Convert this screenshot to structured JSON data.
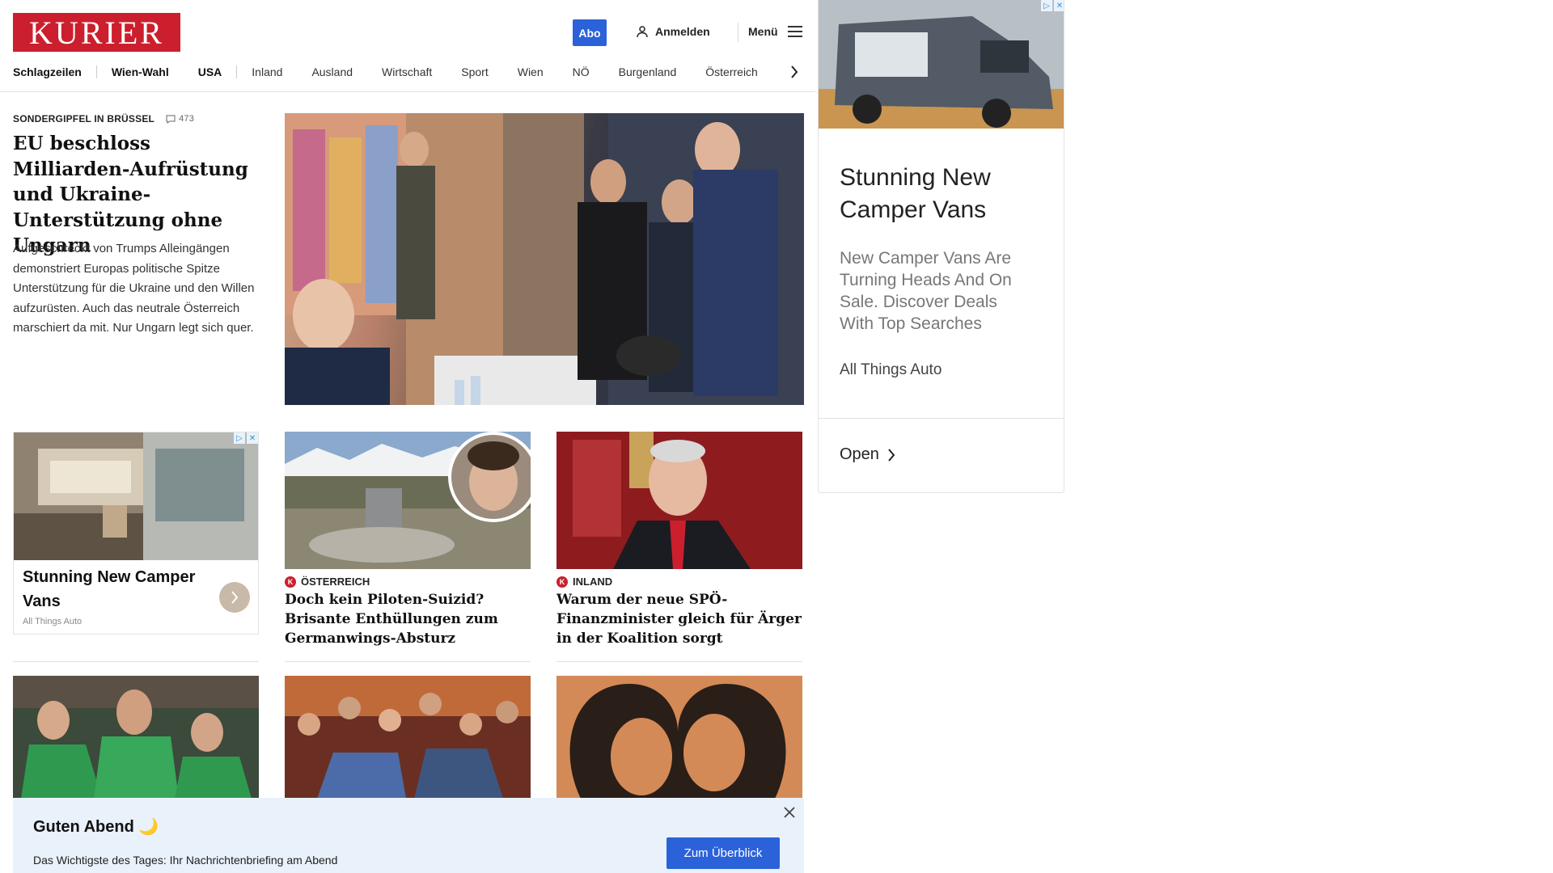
{
  "header": {
    "logo": "KURIER",
    "abo_label": "Abo",
    "login_label": "Anmelden",
    "menu_label": "Menü"
  },
  "nav": {
    "items": [
      "Schlagzeilen",
      "Wien-Wahl",
      "USA",
      "Inland",
      "Ausland",
      "Wirtschaft",
      "Sport",
      "Wien",
      "NÖ",
      "Burgenland",
      "Österreich"
    ]
  },
  "lead": {
    "kicker": "SONDERGIPFEL IN BRÜSSEL",
    "comment_count": "473",
    "title": "EU beschloss Milliarden-Aufrüstung und Ukraine-Unterstützung ohne Ungarn",
    "teaser": "Aufgeschreckt von Trumps Alleingängen demonstriert Europas politische Spitze Unterstützung für die Ukraine und den Willen aufzurüsten. Auch das neutrale Österreich marschiert da mit. Nur Ungarn legt sich quer."
  },
  "ad_small": {
    "title": "Stunning New Camper Vans",
    "brand": "All Things Auto"
  },
  "cards": [
    {
      "badge": "K",
      "kicker": "ÖSTERREICH",
      "title": "Doch kein Piloten-Suizid? Brisante Enthüllungen zum Germanwings-Absturz"
    },
    {
      "badge": "K",
      "kicker": "INLAND",
      "title": "Warum der neue SPÖ-Finanzminister gleich für Ärger in der Koalition sorgt"
    }
  ],
  "ad_right": {
    "title": "Stunning New Camper Vans",
    "desc": "New Camper Vans Are Turning Heads And On Sale. Discover Deals With Top Searches",
    "brand": "All Things Auto",
    "open_label": "Open"
  },
  "banner": {
    "title": "Guten Abend 🌙",
    "text": "Das Wichtigste des Tages: Ihr Nachrichtenbriefing am Abend",
    "button_label": "Zum Überblick"
  },
  "colors": {
    "brand_red": "#cc1f2d",
    "accent_blue": "#2b62d9",
    "banner_bg": "#e9f1fb"
  }
}
